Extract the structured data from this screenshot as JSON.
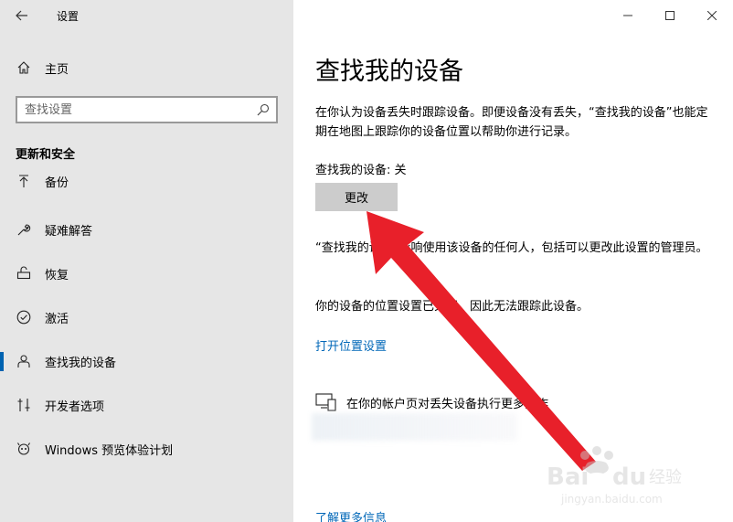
{
  "window": {
    "title": "设置",
    "accent": "#0063b1"
  },
  "sidebar": {
    "home_label": "主页",
    "search_placeholder": "查找设置",
    "section_header": "更新和安全",
    "items": [
      {
        "label": "备份",
        "icon": "backup-icon"
      },
      {
        "label": "疑难解答",
        "icon": "wrench-icon"
      },
      {
        "label": "恢复",
        "icon": "recovery-icon"
      },
      {
        "label": "激活",
        "icon": "check-circle-icon"
      },
      {
        "label": "查找我的设备",
        "icon": "find-device-icon",
        "selected": true
      },
      {
        "label": "开发者选项",
        "icon": "developer-icon"
      },
      {
        "label": "Windows 预览体验计划",
        "icon": "insider-icon"
      }
    ]
  },
  "main": {
    "title": "查找我的设备",
    "description": "在你认为设备丢失时跟踪设备。即便设备没有丢失，“查找我的设备”也能定期在地图上跟踪你的设备位置以帮助你进行记录。",
    "status": "查找我的设备: 关",
    "change_button": "更改",
    "info1": "“查找我的设备”影响使用该设备的任何人，包括可以更改此设置的管理员。",
    "info2": "你的设备的位置设置已关闭，因此无法跟踪此设备。",
    "location_link": "打开位置设置",
    "device_row_text": "在你的帐户页对丢失设备执行更多操作",
    "learn_more_link": "了解更多信息",
    "link_color": "#0067b8"
  },
  "overlay": {
    "arrow_color": "#e8202a"
  },
  "watermark": {
    "brand": "Baidu经验",
    "site": "jingyan.baidu.com"
  }
}
